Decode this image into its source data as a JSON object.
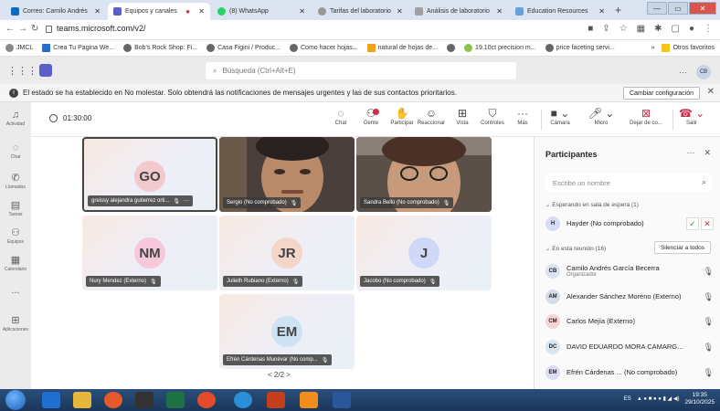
{
  "browser": {
    "tabs": [
      {
        "title": "Correo: Camilo Andrés",
        "color": "#0f6cbd"
      },
      {
        "title": "Equipos y canales",
        "color": "#5b5fc7"
      },
      {
        "title": "(8) WhatsApp",
        "color": "#25d366"
      },
      {
        "title": "Tarifas del laboratorio",
        "color": "#888888"
      },
      {
        "title": "Análisis de laboratorio",
        "color": "#888888"
      },
      {
        "title": "Education Resources",
        "color": "#6aa0d8"
      }
    ],
    "url": "teams.microsoft.com/v2/",
    "bookmarks": [
      "JMCL",
      "Crea Tu Pagina We...",
      "Bob's Rock Shop: Fi...",
      "Casa Figini / Produc...",
      "Como hacer hojas...",
      "natural de hojas de...",
      "19.10ct precision m...",
      "price faceting servi..."
    ],
    "other_bookmarks": "Otros favoritos"
  },
  "teams": {
    "search_placeholder": "Búsqueda (Ctrl+Alt+E)",
    "user_initials": "CB",
    "banner_text": "El estado se ha establecido en No molestar. Solo obtendrá las notificaciones de mensajes urgentes y las de sus contactos prioritarios.",
    "banner_button": "Cambiar configuración",
    "rail": [
      {
        "icon": "bell",
        "label": "Actividad"
      },
      {
        "icon": "chat",
        "label": "Chat"
      },
      {
        "icon": "phone",
        "label": "Llamadas"
      },
      {
        "icon": "tasks",
        "label": "Tareas"
      },
      {
        "icon": "teams",
        "label": "Equipos"
      },
      {
        "icon": "calendar",
        "label": "Calendario"
      },
      {
        "icon": "more",
        "label": "..."
      },
      {
        "icon": "apps",
        "label": "Aplicaciones"
      }
    ]
  },
  "meeting": {
    "timer": "01:30:00",
    "toolbar": {
      "chat": "Chat",
      "people": "Gente",
      "raise": "Participar",
      "react": "Reaccionar",
      "view": "Vista",
      "controls": "Controles",
      "more": "Más",
      "camera": "Cámara",
      "mic": "Micro",
      "share": "Dejar de co...",
      "leave": "Salir"
    },
    "tiles": [
      {
        "initials": "GO",
        "name": "greissy alejandra gutierrez orti...",
        "avatar": "#f2c9cc",
        "video": false
      },
      {
        "initials": "",
        "name": "Sergio (No comprobado)",
        "avatar": "",
        "video": true
      },
      {
        "initials": "",
        "name": "Sandra Bello (No comprobado)",
        "avatar": "",
        "video": true
      },
      {
        "initials": "NM",
        "name": "Nury Mendez (Externo)",
        "avatar": "#f6c8da",
        "video": false
      },
      {
        "initials": "JR",
        "name": "Julieth Rubiano (Externo)",
        "avatar": "#f3d5c9",
        "video": false
      },
      {
        "initials": "J",
        "name": "Jacobo (No comprobado)",
        "avatar": "#cfd8f7",
        "video": false
      },
      {
        "initials": "EM",
        "name": "Efrén Cárdenas Munévar (No comp...",
        "avatar": "#cde3f4",
        "video": false
      }
    ],
    "pager": "< 2/2 >"
  },
  "participants": {
    "title": "Participantes",
    "search_placeholder": "Escribe un nombre",
    "waiting_label": "Esperando en sala de espera (1)",
    "waiting": [
      {
        "initials": "H",
        "name": "Hayder (No comprobado)",
        "color": "#d7dcf7"
      }
    ],
    "in_meeting_label": "En esta reunión (16)",
    "mute_all": "Silenciar a todos",
    "people": [
      {
        "initials": "CB",
        "name": "Camilo Andrés García Becerra",
        "role": "Organizador",
        "color": "#dbe3f3"
      },
      {
        "initials": "AM",
        "name": "Alexander Sánchez Moreno (Externo)",
        "role": "",
        "color": "#d6dde8"
      },
      {
        "initials": "CM",
        "name": "Carlos Mejía (Externo)",
        "role": "",
        "color": "#f6d3d5"
      },
      {
        "initials": "DC",
        "name": "DAVID EDUARDO MORA CAMARG...",
        "role": "",
        "color": "#d9e6ef"
      },
      {
        "initials": "EM",
        "name": "Efrén Cárdenas ... (No comprobado)",
        "role": "",
        "color": "#dcdcf4"
      }
    ]
  },
  "taskbar": {
    "lang": "ES",
    "time": "19:35",
    "date": "29/10/2025"
  }
}
